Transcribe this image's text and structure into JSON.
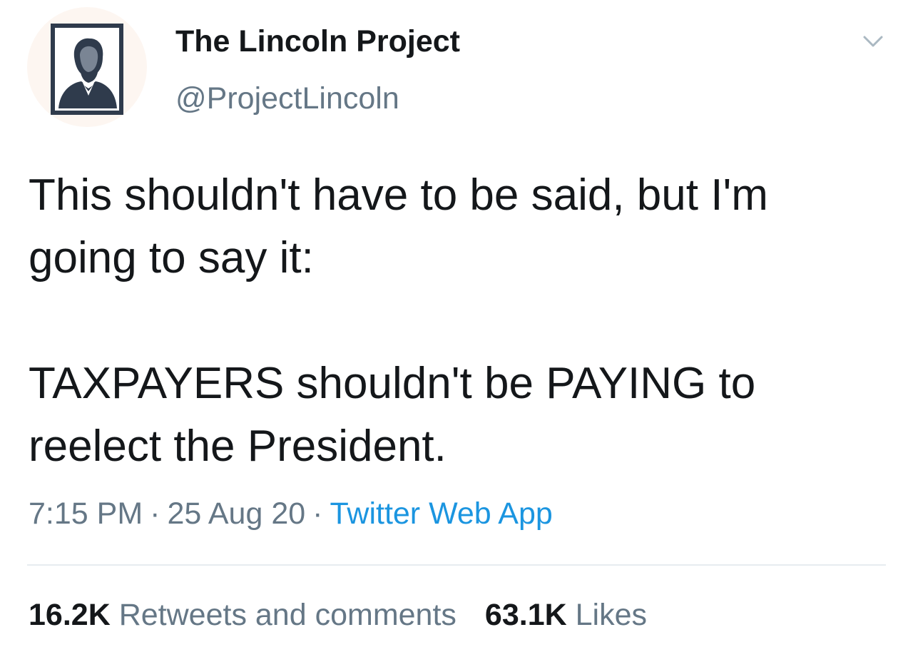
{
  "author": {
    "name": "The Lincoln Project",
    "handle": "@ProjectLincoln",
    "avatar_icon": "lincoln-portrait-icon"
  },
  "tweet": {
    "lines": [
      "This shouldn't have to be said, but I'm",
      "going to say it:",
      "TAXPAYERS shouldn't be PAYING to",
      "reelect the President."
    ],
    "time": "7:15 PM",
    "date": "25 Aug 20",
    "separator": "·",
    "source": "Twitter Web App"
  },
  "stats": {
    "retweets_count": "16.2K",
    "retweets_label": "Retweets and comments",
    "likes_count": "63.1K",
    "likes_label": "Likes"
  },
  "icons": {
    "more": "chevron-down-icon"
  },
  "colors": {
    "text_primary": "#14171a",
    "text_secondary": "#657786",
    "link": "#1b95e0",
    "divider": "#e6ecf0",
    "avatar_bg": "#fdf6f1",
    "avatar_frame": "#2f3b4c"
  }
}
